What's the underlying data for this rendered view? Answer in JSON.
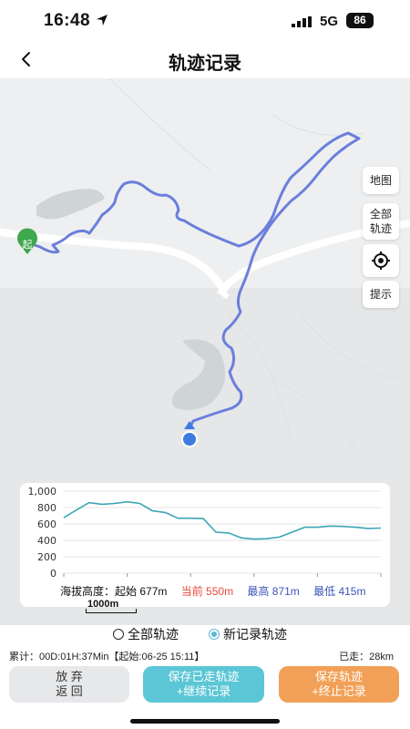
{
  "status": {
    "time": "16:48",
    "network": "5G",
    "battery": "86"
  },
  "nav": {
    "title": "轨迹记录"
  },
  "map": {
    "start_label": "起",
    "side_buttons": {
      "map": "地图",
      "full_track_l1": "全部",
      "full_track_l2": "轨迹",
      "hint": "提示"
    },
    "scale_label": "1000m"
  },
  "elevation": {
    "y_ticks": [
      "1,000",
      "800",
      "600",
      "400",
      "200",
      "0"
    ],
    "label": "海拔高度：",
    "start": "起始 677m",
    "current": "当前 550m",
    "max": "最高 871m",
    "min": "最低 415m"
  },
  "chart_data": {
    "type": "line",
    "title": "",
    "xlabel": "",
    "ylabel": "",
    "ylim": [
      0,
      1000
    ],
    "x": [
      0,
      4,
      8,
      12,
      16,
      20,
      24,
      28,
      32,
      36,
      40,
      44,
      48,
      52,
      56,
      60,
      64,
      68,
      72,
      76,
      80,
      84,
      88,
      92,
      96,
      100
    ],
    "series": [
      {
        "values": [
          677,
          770,
          860,
          840,
          850,
          870,
          850,
          760,
          740,
          670,
          670,
          665,
          500,
          490,
          430,
          415,
          420,
          440,
          500,
          560,
          560,
          575,
          570,
          560,
          545,
          550
        ]
      }
    ],
    "colors": {
      "line": "#3ba6b5",
      "current": "#e8473a",
      "max": "#3a56b8",
      "min": "#3a56b8"
    }
  },
  "radio": {
    "all_tracks": "全部轨迹",
    "new_track": "新记录轨迹"
  },
  "stats": {
    "cumulative": "累计：00D:01H:37Min【起始:06-25 15:11】",
    "walked": "已走：28km"
  },
  "buttons": {
    "discard_l1": "放 弃",
    "discard_l2": "返 回",
    "save_continue_l1": "保存已走轨迹",
    "save_continue_l2": "+继续记录",
    "save_end_l1": "保存轨迹",
    "save_end_l2": "+终止记录"
  },
  "colors": {
    "track": "#6a7fdc",
    "btn_gray": "#e7e8ea",
    "btn_teal": "#5bc6d6",
    "btn_orange": "#f2a057",
    "start_marker": "#3fa74d"
  }
}
